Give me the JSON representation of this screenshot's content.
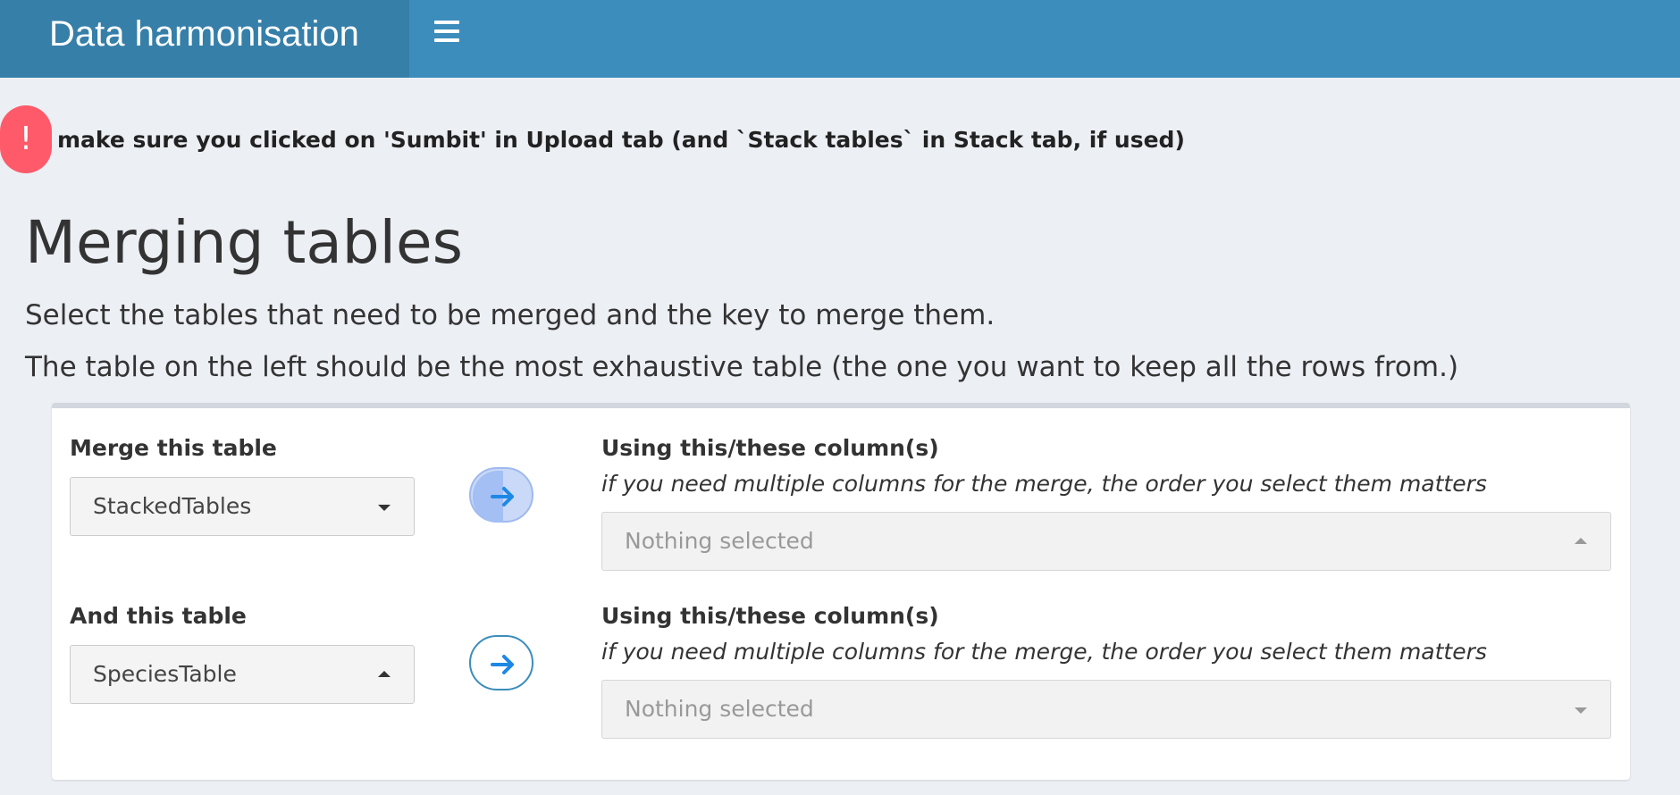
{
  "header": {
    "title": "Data harmonisation",
    "menu_icon": "hamburger-menu-icon"
  },
  "alert": {
    "icon_glyph": "!",
    "icon_name": "exclamation-icon",
    "text": "make sure you clicked on 'Sumbit' in Upload tab (and `Stack tables` in Stack tab, if used)",
    "color": "#ff5a6a"
  },
  "page": {
    "title": "Merging tables",
    "description_1": "Select the tables that need to be merged and the key to merge them.",
    "description_2": "The table on the left should be the most exhaustive table (the one you want to keep all the rows from.)"
  },
  "merge": {
    "left_table": {
      "label": "Merge this table",
      "selected": "StackedTables",
      "columns_label": "Using this/these column(s)",
      "columns_hint": "if you need multiple columns for the merge, the order you select them matters",
      "columns_selected": "Nothing selected"
    },
    "right_table": {
      "label": "And this table",
      "selected": "SpeciesTable",
      "columns_label": "Using this/these column(s)",
      "columns_hint": "if you need multiple columns for the merge, the order you select them matters",
      "columns_selected": "Nothing selected"
    },
    "arrow_icon": "arrow-right-icon"
  },
  "colors": {
    "header": "#3c8dbc",
    "brand": "#367fa9",
    "accent": "#1e88e5",
    "background": "#eceff4"
  }
}
